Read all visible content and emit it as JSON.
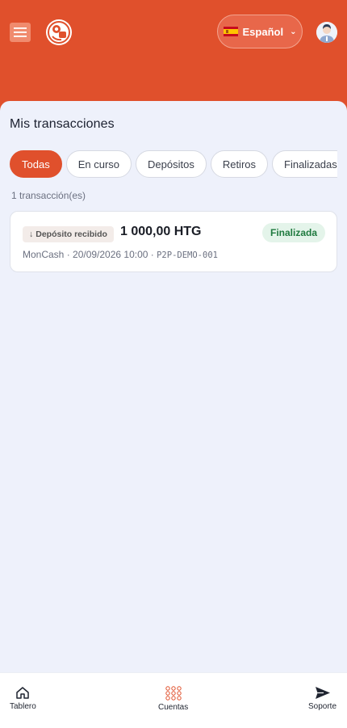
{
  "header": {
    "language_label": "Español",
    "icons": {
      "menu": "menu-icon",
      "logo": "brand-logo",
      "flag": "spain-flag-icon",
      "avatar": "user-avatar-icon"
    },
    "brand_color": "#e0502c"
  },
  "page": {
    "title": "Mis transacciones",
    "count_text": "1 transacción(es)"
  },
  "tabs": [
    {
      "label": "Todas",
      "active": true
    },
    {
      "label": "En curso",
      "active": false
    },
    {
      "label": "Depósitos",
      "active": false
    },
    {
      "label": "Retiros",
      "active": false
    },
    {
      "label": "Finalizadas",
      "active": false
    }
  ],
  "transactions": [
    {
      "type_label": "Depósito recibido",
      "type_arrow": "↓",
      "amount": "1 000,00 HTG",
      "status": "Finalizada",
      "status_color": "#1f7a3f",
      "meta": "MonCash · 20/09/2026 10:00 · ",
      "reference": "P2P-DEMO-001"
    }
  ],
  "bottom_nav": [
    {
      "label": "Tablero",
      "icon": "home-icon"
    },
    {
      "label": "Cuentas",
      "icon": "grid-dots-icon"
    },
    {
      "label": "Soporte",
      "icon": "send-icon"
    }
  ]
}
